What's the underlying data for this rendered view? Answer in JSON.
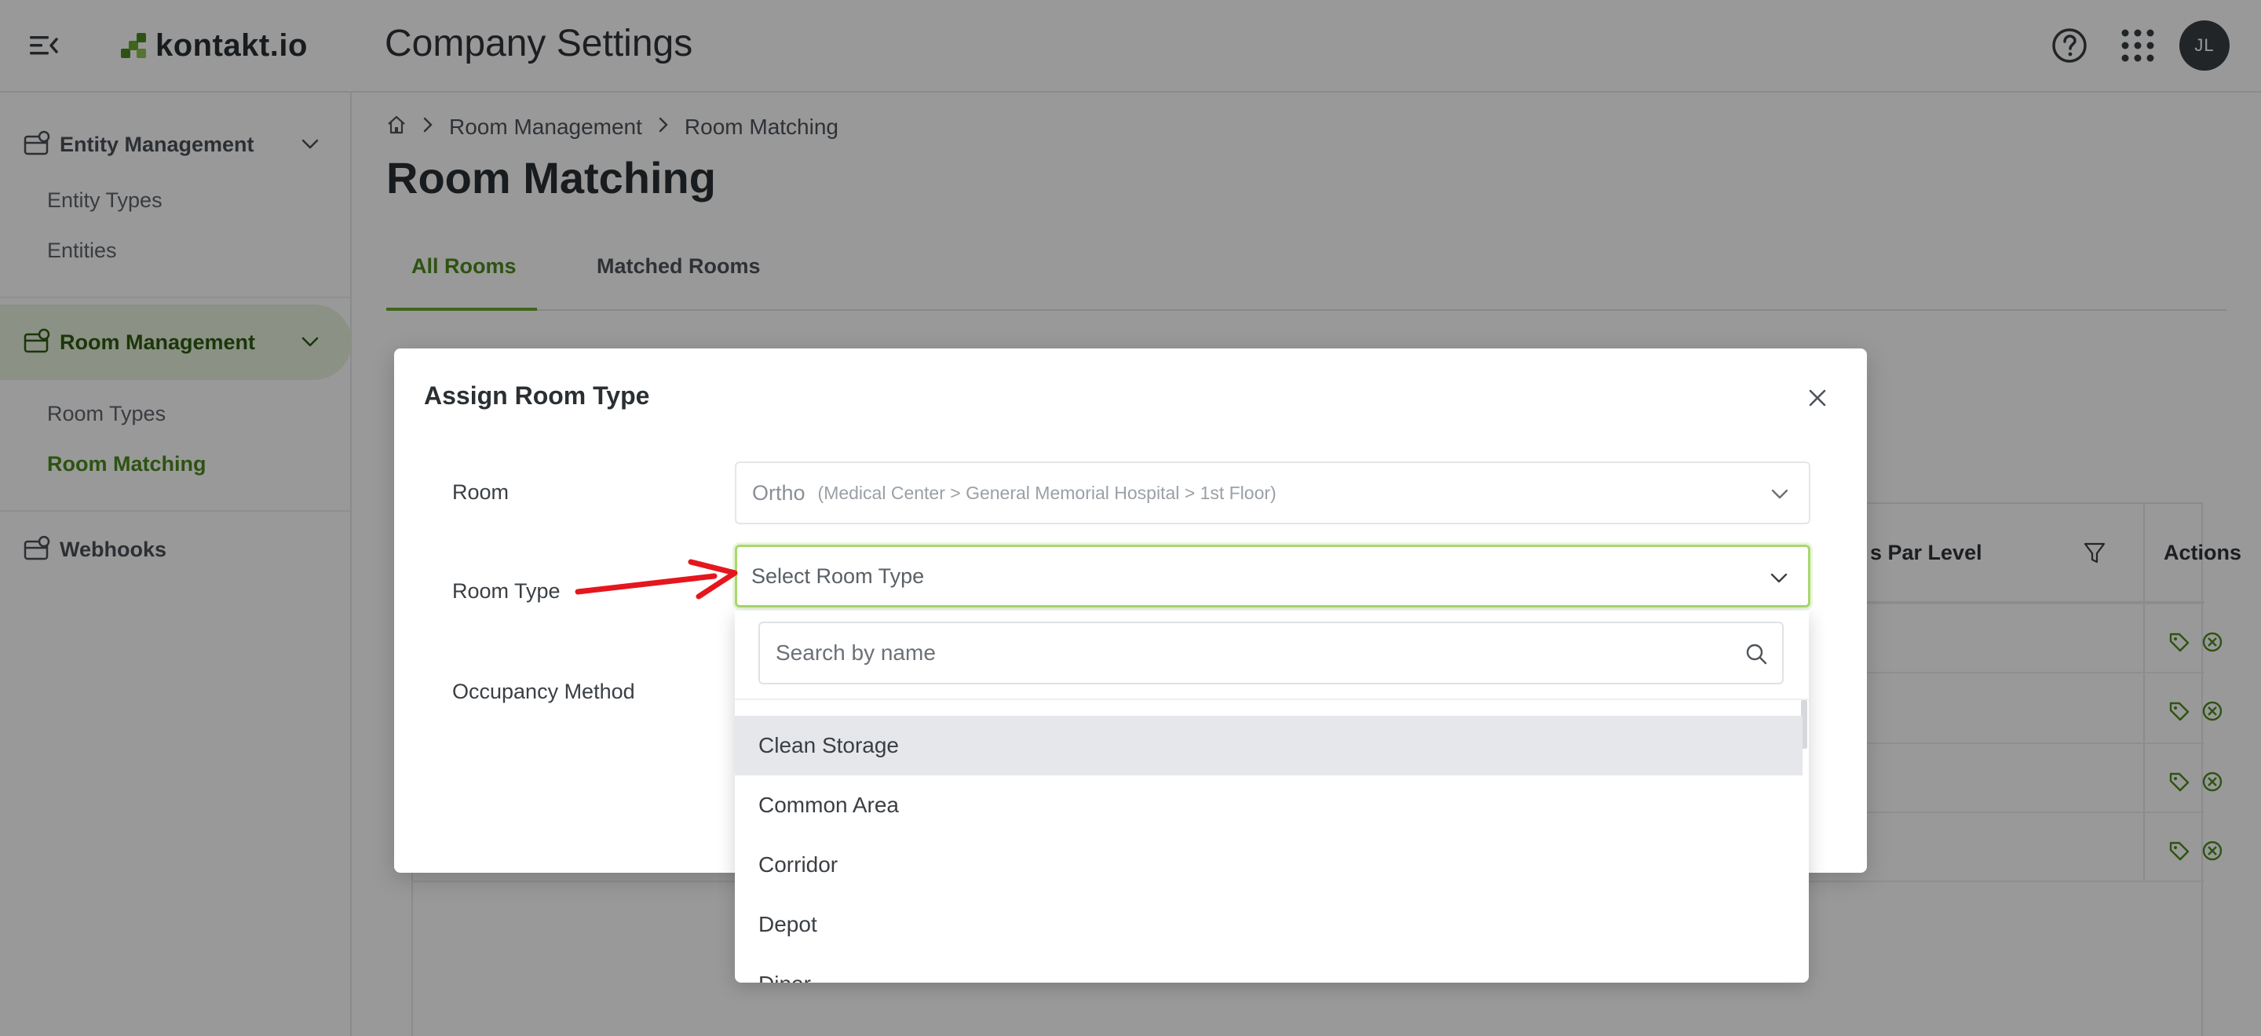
{
  "header": {
    "logo_text": "kontakt.io",
    "app_title": "Company Settings",
    "avatar_initials": "JL",
    "icons": [
      "collapse-menu-icon",
      "help-icon",
      "apps-grid-icon"
    ]
  },
  "sidebar": {
    "groups": [
      {
        "label": "Entity Management",
        "icon": "entity-icon",
        "items": [
          "Entity Types",
          "Entities"
        ]
      },
      {
        "label": "Room Management",
        "icon": "room-icon",
        "items": [
          "Room Types",
          "Room Matching"
        ],
        "active_item": "Room Matching"
      },
      {
        "label": "Webhooks",
        "icon": "webhook-icon",
        "items": []
      }
    ]
  },
  "breadcrumb": {
    "items": [
      "Room Management",
      "Room Matching"
    ]
  },
  "page": {
    "title": "Room Matching"
  },
  "tabs": [
    {
      "label": "All Rooms",
      "active": true
    },
    {
      "label": "Matched Rooms",
      "active": false
    }
  ],
  "table": {
    "visible_headers": [
      "s Par Level",
      "Actions"
    ],
    "row_count": 4
  },
  "modal": {
    "title": "Assign Room Type",
    "fields": {
      "room_label": "Room",
      "room_value": "Ortho",
      "room_path": "(Medical Center > General Memorial Hospital > 1st Floor)",
      "room_type_label": "Room Type",
      "room_type_placeholder": "Select Room Type",
      "occupancy_label": "Occupancy Method"
    },
    "dropdown": {
      "search_placeholder": "Search by name",
      "options": [
        "Clean Storage",
        "Common Area",
        "Corridor",
        "Depot",
        "Diner"
      ],
      "highlighted": "Clean Storage"
    }
  },
  "colors": {
    "brand_green": "#4b8b1e",
    "focus_border": "#a8d86e",
    "annotation_arrow": "#e5161d"
  }
}
